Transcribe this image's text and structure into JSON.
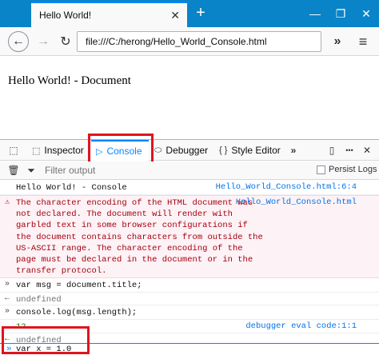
{
  "tab": {
    "title": "Hello World!",
    "close_glyph": "✕",
    "new_tab_glyph": "+"
  },
  "window": {
    "minimize": "—",
    "restore": "❐",
    "close": "✕"
  },
  "nav": {
    "back_glyph": "←",
    "forward_glyph": "→",
    "reload_glyph": "↻",
    "url": "file:///C:/herong/Hello_World_Console.html",
    "overflow_glyph": "»",
    "menu_glyph": "≡"
  },
  "document": {
    "text": "Hello World! - Document"
  },
  "devtools": {
    "tabs": [
      {
        "label": "Inspector",
        "icon": "inspector-icon",
        "glyph": "⬚"
      },
      {
        "label": "Console",
        "icon": "console-icon",
        "glyph": "▷"
      },
      {
        "label": "Debugger",
        "icon": "debugger-icon",
        "glyph": "⬭"
      },
      {
        "label": "Style Editor",
        "icon": "style-editor-icon",
        "glyph": "{ }"
      }
    ],
    "picker_glyph": "⬚",
    "more_tabs_glyph": "»",
    "dock_glyph": "▯",
    "options_glyph": "•••",
    "close_glyph": "✕",
    "filter": {
      "trash_glyph": "🗑",
      "funnel_glyph": "⏷",
      "placeholder": "Filter output",
      "persist_label": "Persist Logs"
    },
    "accent_color": "#0a84ff",
    "highlight_color": "#e0141e"
  },
  "console": {
    "log1": {
      "text": "Hello World! - Console",
      "source": "Hello_World_Console.html:6:4"
    },
    "error": {
      "glyph": "⚠",
      "lines": [
        "The character encoding of the HTML document was",
        "not declared. The document will render with",
        "garbled text in some browser configurations if",
        "the document contains characters from outside the",
        "US-ASCII range. The character encoding of the",
        "page must be declared in the document or in the",
        "transfer protocol."
      ],
      "source": "Hello_World_Console.html"
    },
    "cmd1": {
      "prompt": "»",
      "text": "var msg = document.title;"
    },
    "result1": {
      "prompt": "←",
      "text": "undefined"
    },
    "cmd2": {
      "prompt": "»",
      "text": "console.log(msg.length);"
    },
    "log2": {
      "text": "12",
      "source": "debugger eval code:1:1"
    },
    "result2": {
      "prompt": "←",
      "text": "undefined"
    },
    "input": {
      "prompt": "»",
      "text": "var x = 1.0"
    }
  }
}
